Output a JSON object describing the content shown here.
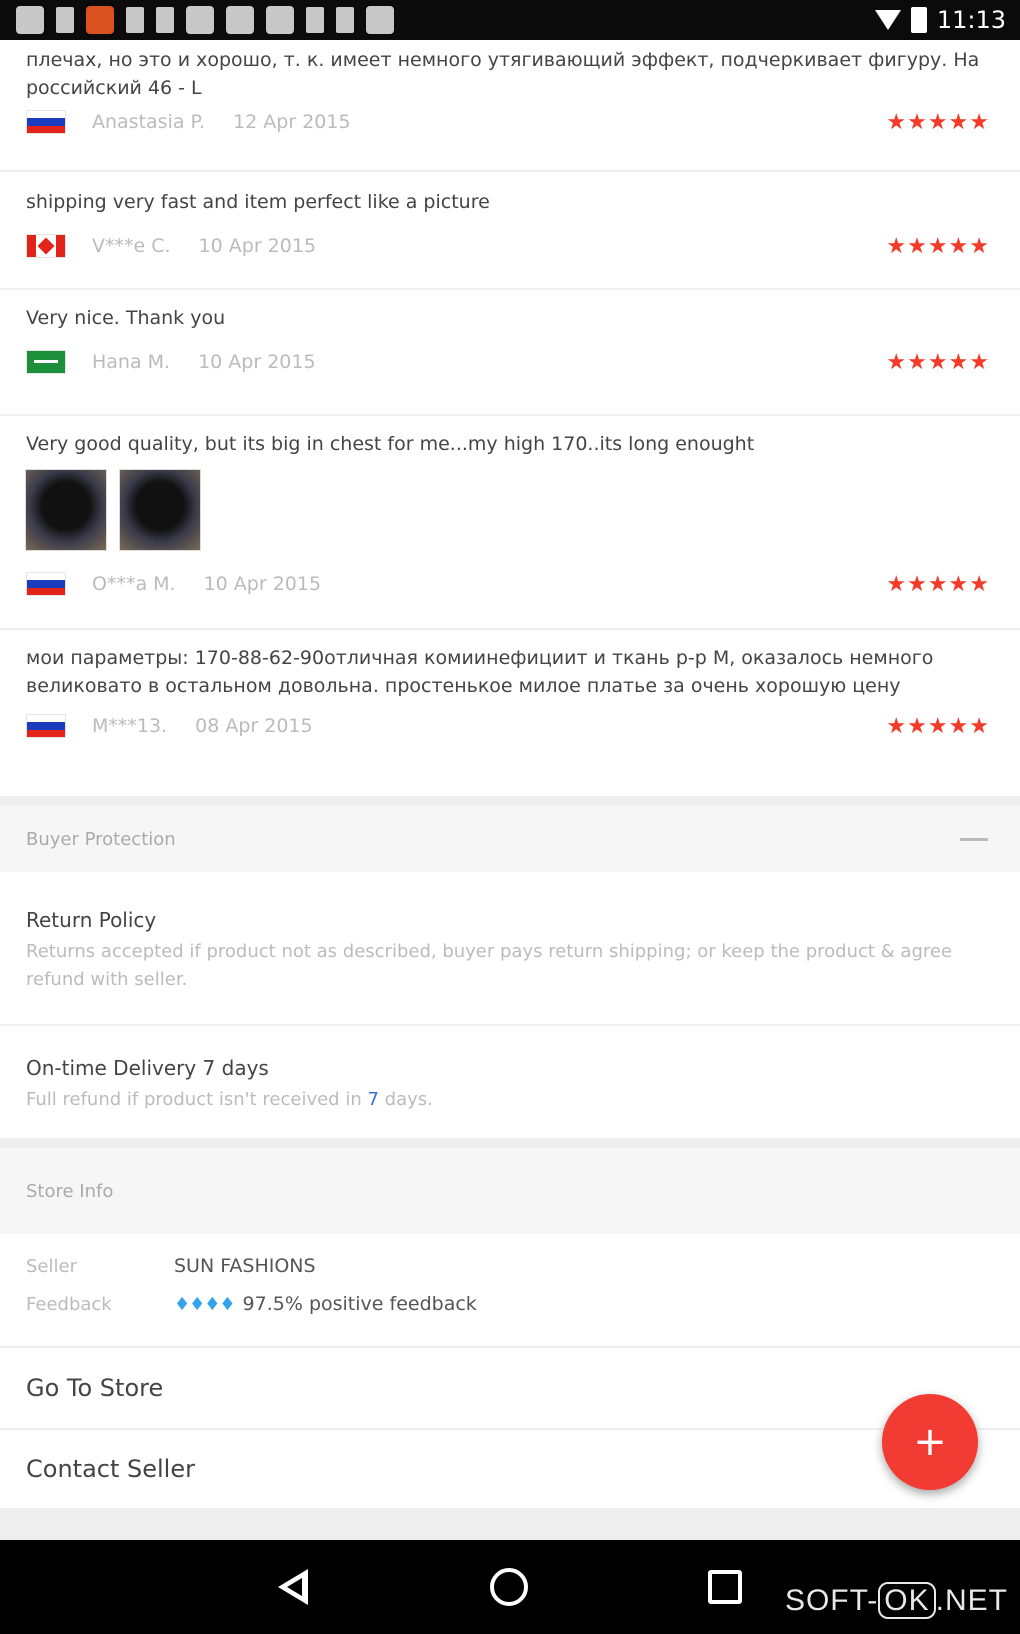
{
  "status_bar": {
    "time": "11:13",
    "icons": [
      "whatsapp-icon",
      "download-icon",
      "news-icon",
      "pin-icon",
      "sim-icon",
      "calendar-icon",
      "mail-icon",
      "image-icon",
      "file-icon",
      "pin-icon",
      "camera-icon"
    ]
  },
  "reviews": [
    {
      "text_top": "плечах, но это и хорошо, т. к. имеет немного утягивающий эффект, подчеркивает фигуру. На российский 46 - L",
      "flag": "russia",
      "reviewer": "Anastasia P.",
      "date": "12 Apr 2015",
      "stars": "★★★★★"
    },
    {
      "text": "shipping very fast and item perfect like a picture",
      "flag": "canada",
      "reviewer": "V***e C.",
      "date": "10 Apr 2015",
      "stars": "★★★★★"
    },
    {
      "text": "Very nice. Thank you",
      "flag": "saudi-arabia",
      "reviewer": "Hana M.",
      "date": "10 Apr 2015",
      "stars": "★★★★★"
    },
    {
      "text": "Very good quality, but its big in chest for me...my high 170..its long enought",
      "flag": "russia",
      "reviewer": "O***a M.",
      "date": "10 Apr 2015",
      "stars": "★★★★★"
    },
    {
      "text": "мои параметры: 170-88-62-90отличная комиинефициит и ткань р-р M, оказалось немного великовато в остальном довольна. простенькое милое платье за очень хорошую цену",
      "flag": "russia",
      "reviewer": "M***13.",
      "date": "08 Apr 2015",
      "stars": "★★★★★"
    }
  ],
  "buyer_protection": {
    "header": "Buyer Protection",
    "return_policy_title": "Return Policy",
    "return_policy_desc": "Returns accepted if product not as described, buyer pays return shipping; or keep the product & agree refund with seller.",
    "delivery_title": "On-time Delivery 7 days",
    "delivery_desc_prefix": "Full refund if product isn't received in ",
    "delivery_days": "7",
    "delivery_desc_suffix": " days."
  },
  "store_info": {
    "header": "Store Info",
    "seller_label": "Seller",
    "seller_value": "SUN FASHIONS",
    "feedback_label": "Feedback",
    "feedback_diamonds": "♦♦♦♦",
    "feedback_value": "97.5% positive feedback"
  },
  "actions": {
    "go_to_store": "Go To Store",
    "contact_seller": "Contact Seller"
  },
  "fab": {
    "symbol": "+"
  },
  "watermark": {
    "prefix": "SOFT-",
    "boxed": "OK",
    "suffix": ".NET"
  }
}
